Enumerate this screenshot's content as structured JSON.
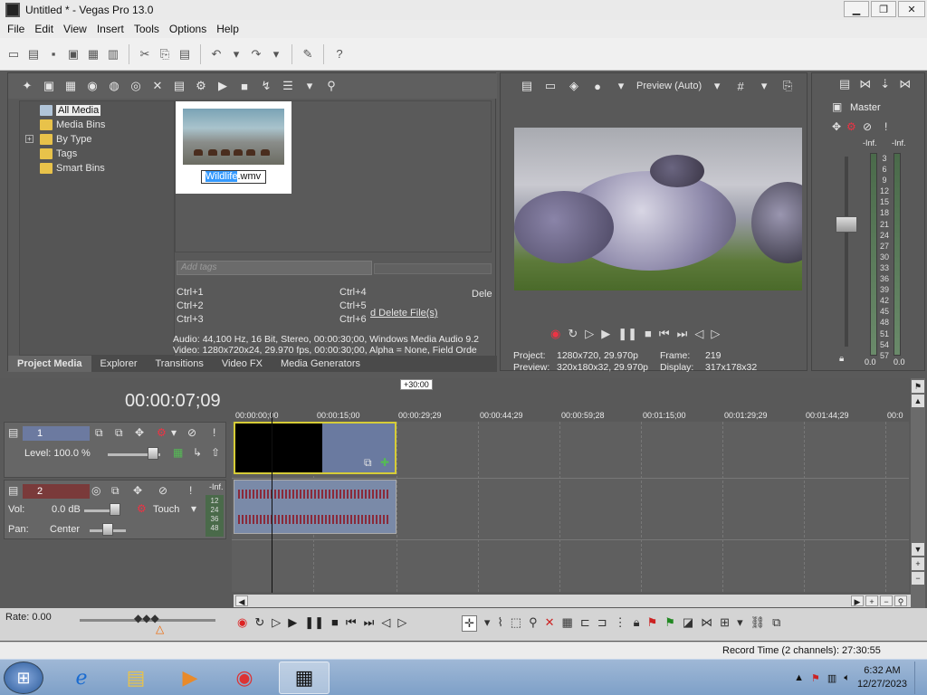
{
  "window": {
    "title": "Untitled * - Vegas Pro 13.0",
    "minimize_icon": "minimize-icon",
    "restore_icon": "restore-icon",
    "close_icon": "close-icon"
  },
  "menu": [
    "File",
    "Edit",
    "View",
    "Insert",
    "Tools",
    "Options",
    "Help"
  ],
  "project_media": {
    "tree": [
      "All Media",
      "Media Bins",
      "By Type",
      "Tags",
      "Smart Bins"
    ],
    "file_name": {
      "selected": "Wildlife",
      "rest": ".wmv"
    },
    "tags_placeholder": "Add tags",
    "shortcuts": [
      "Ctrl+1",
      "Ctrl+2",
      "Ctrl+3",
      "Ctrl+4",
      "Ctrl+5",
      "Ctrl+6"
    ],
    "delete_label": "d Delete File(s)",
    "delete_short": "Dele",
    "audio_info": "Audio: 44,100 Hz, 16 Bit, Stereo, 00:00:30;00, Windows Media Audio 9.2",
    "video_info": "Video: 1280x720x24, 29.970 fps, 00:00:30;00, Alpha = None, Field Orde",
    "tabs": [
      "Project Media",
      "Explorer",
      "Transitions",
      "Video FX",
      "Media Generators"
    ]
  },
  "preview": {
    "mode": "Preview (Auto)",
    "project_label": "Project:",
    "project_value": "1280x720, 29.970p",
    "preview_label": "Preview:",
    "preview_value": "320x180x32, 29.970p",
    "frame_label": "Frame:",
    "frame_value": "219",
    "display_label": "Display:",
    "display_value": "317x178x32"
  },
  "master": {
    "label": "Master",
    "inf_left": "-Inf.",
    "inf_right": "-Inf.",
    "scale": [
      "3",
      "6",
      "9",
      "12",
      "15",
      "18",
      "21",
      "24",
      "27",
      "30",
      "33",
      "36",
      "39",
      "42",
      "45",
      "48",
      "51",
      "54",
      "57"
    ],
    "bottom_left": "0.0",
    "bottom_right": "0.0"
  },
  "timeline": {
    "timecode": "00:00:07;09",
    "badge": "+30:00",
    "ruler": [
      "00:00:00;00",
      "00:00:15;00",
      "00:00:29;29",
      "00:00:44;29",
      "00:00:59;28",
      "00:01:15;00",
      "00:01:29;29",
      "00:01:44;29",
      "00:0"
    ],
    "video_track": {
      "number": "1",
      "level": "Level: 100.0 %"
    },
    "audio_track": {
      "number": "2",
      "vol_label": "Vol:",
      "vol_value": "0.0 dB",
      "pan_label": "Pan:",
      "pan_value": "Center",
      "mode": "Touch",
      "inf": "-Inf.",
      "meter": [
        "12",
        "24",
        "36",
        "48"
      ]
    }
  },
  "bottom": {
    "rate": "Rate: 0.00",
    "record_time": "Record Time (2 channels): 27:30:55"
  },
  "taskbar": {
    "time": "6:32 AM",
    "date": "12/27/2023"
  }
}
